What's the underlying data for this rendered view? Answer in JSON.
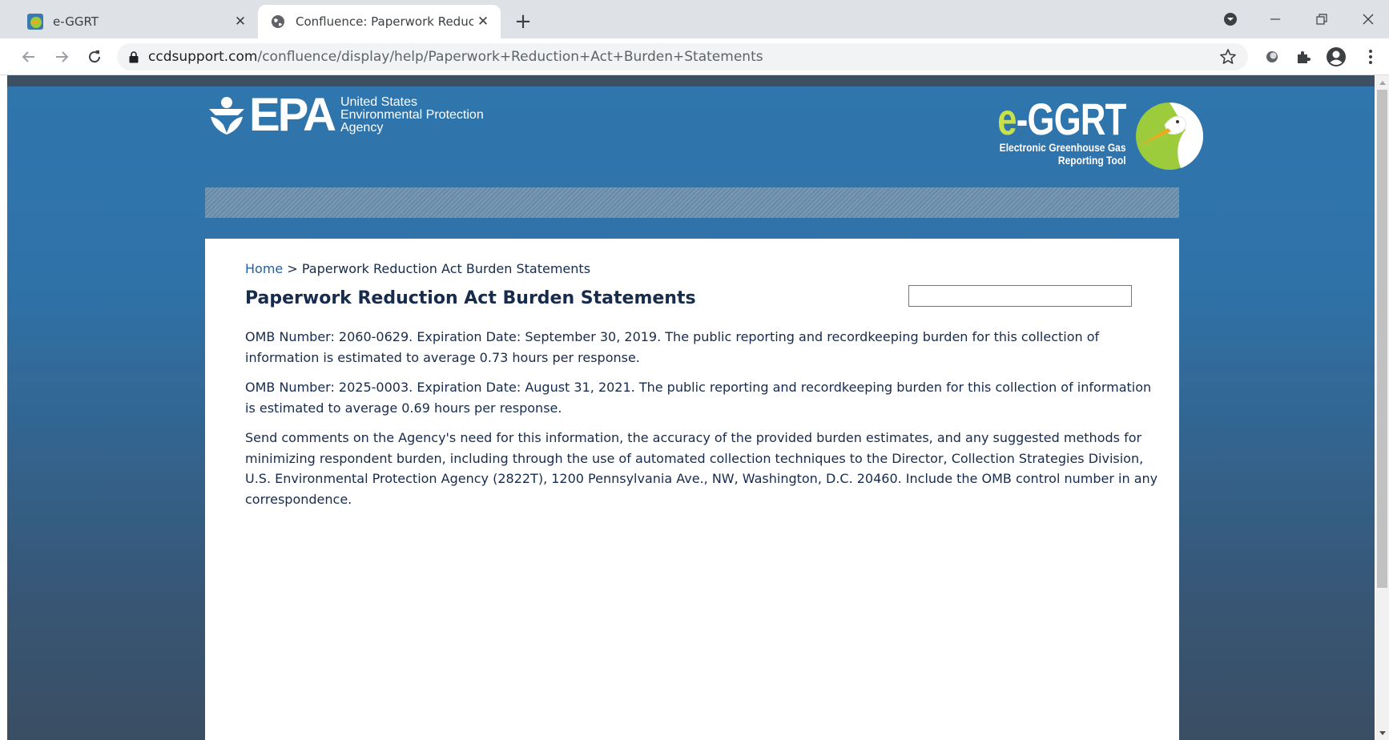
{
  "browser": {
    "tabs": [
      {
        "title": "e-GGRT",
        "active": false
      },
      {
        "title": "Confluence: Paperwork Reduction Act Burden Statements",
        "active": true
      }
    ],
    "url": {
      "host": "ccdsupport.com",
      "path": "/confluence/display/help/Paperwork+Reduction+Act+Burden+Statements"
    },
    "icons": [
      "back-icon",
      "forward-icon",
      "reload-icon",
      "lock-icon",
      "star-icon",
      "extension-icon",
      "puzzle-icon",
      "profile-icon",
      "menu-icon",
      "minimize-icon",
      "restore-icon",
      "close-icon",
      "new-tab-icon",
      "tab-search-icon"
    ]
  },
  "header": {
    "epa": {
      "word": "EPA",
      "line1": "United States",
      "line2": "Environmental Protection",
      "line3": "Agency"
    },
    "eggrt": {
      "name_prefix": "e",
      "name_rest": "-GGRT",
      "tagline1": "Electronic Greenhouse Gas",
      "tagline2": "Reporting Tool"
    }
  },
  "main": {
    "breadcrumb": {
      "home": "Home",
      "separator": ">",
      "current": "Paperwork Reduction Act Burden Statements"
    },
    "title": "Paperwork Reduction Act Burden Statements",
    "search": {
      "value": "",
      "placeholder": ""
    },
    "paragraphs": [
      "OMB Number: 2060-0629. Expiration Date: September 30, 2019. The public reporting and recordkeeping burden for this collection of information is estimated to average 0.73 hours per response.",
      "OMB Number: 2025-0003. Expiration Date: August 31, 2021. The public reporting and recordkeeping burden for this collection of information is estimated to average 0.69 hours per response.",
      "Send comments on the Agency's need for this information, the accuracy of the provided burden estimates, and any suggested methods for minimizing respondent burden, including through the use of automated collection techniques to the Director, Collection Strategies Division, U.S. Environmental Protection Agency (2822T), 1200 Pennsylvania Ave., NW, Washington, D.C. 20460. Include the OMB control number in any correspondence."
    ]
  },
  "colors": {
    "header_blue": "#2f76ae",
    "link_blue": "#1f5fa8",
    "eggrt_green": "#c8e04a"
  }
}
